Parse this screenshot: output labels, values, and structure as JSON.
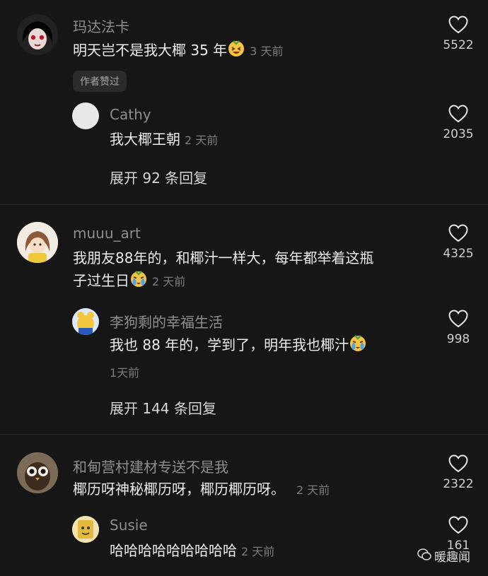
{
  "comments": [
    {
      "user": "玛达法卡",
      "text": "明天岂不是我大椰 35 年",
      "time": "3 天前",
      "likes": "5522",
      "badge": "作者赞过",
      "reply": {
        "user": "Cathy",
        "text": "我大椰王朝",
        "time": "2 天前",
        "likes": "2035"
      },
      "expand": "展开 92 条回复"
    },
    {
      "user": "muuu_art",
      "text_line1": "我朋友88年的，和椰汁一样大，每年都举着这瓶",
      "text_line2": "子过生日",
      "time": "2 天前",
      "likes": "4325",
      "reply": {
        "user": "李狗剩的幸福生活",
        "text": "我也 88 年的，学到了，明年我也椰汁",
        "time": "1天前",
        "likes": "998"
      },
      "expand": "展开 144 条回复"
    },
    {
      "user": "和甸营村建材专送不是我",
      "text": "椰历呀神秘椰历呀，椰历椰历呀。",
      "time": "2 天前",
      "likes": "2322",
      "reply": {
        "user": "Susie",
        "text": "哈哈哈哈哈哈哈哈哈",
        "time": "2 天前",
        "likes": "161"
      }
    }
  ],
  "watermark": "暖趣闻",
  "colors": {
    "background": "#161616",
    "username": "#8e8e8e",
    "text": "#ececec"
  },
  "icons": [
    "heart-icon",
    "laughing-emoji",
    "crying-emoji",
    "wechat-icon"
  ]
}
